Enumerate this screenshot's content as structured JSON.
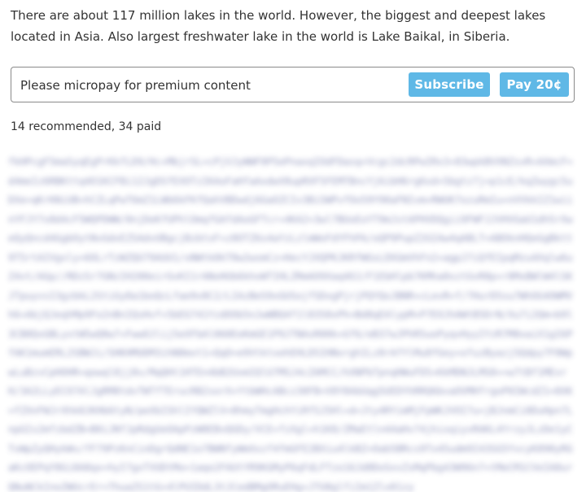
{
  "intro": {
    "text": "There are about 117 million lakes in the world. However, the biggest and deepest lakes located in Asia. Also largest freshwater lake in the world is Lake Baikal, in Siberia."
  },
  "paywall": {
    "prompt": "Please micropay for premium content",
    "subscribe_label": "Subscribe",
    "pay_label": "Pay 20¢"
  },
  "stats": {
    "text": "14 recommended, 34 paid"
  },
  "premium": {
    "blurred": true
  },
  "colors": {
    "button": "#5fb8e6",
    "border": "#8a8a8a",
    "text": "#333333"
  }
}
